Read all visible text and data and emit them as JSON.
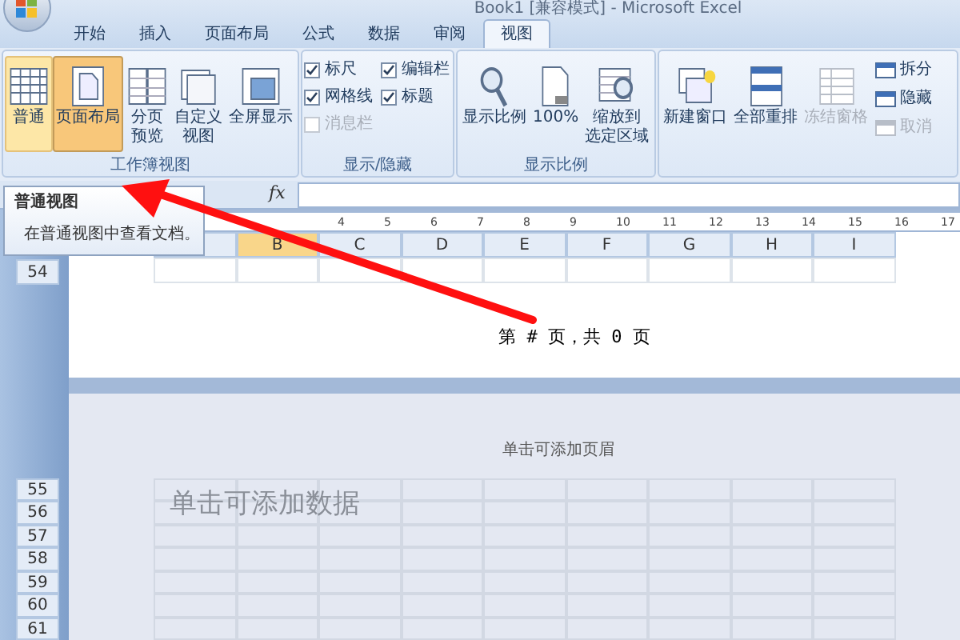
{
  "window": {
    "title": "Book1 [兼容模式] - Microsoft Excel"
  },
  "tabs": [
    {
      "label": "开始",
      "selected": false
    },
    {
      "label": "插入",
      "selected": false
    },
    {
      "label": "页面布局",
      "selected": false
    },
    {
      "label": "公式",
      "selected": false
    },
    {
      "label": "数据",
      "selected": false
    },
    {
      "label": "审阅",
      "selected": false
    },
    {
      "label": "视图",
      "selected": true
    }
  ],
  "workbook_views": {
    "label": "工作簿视图",
    "buttons": [
      {
        "lines": [
          "普通"
        ],
        "hovered": true,
        "selected": false
      },
      {
        "lines": [
          "页面布局"
        ],
        "hovered": false,
        "selected": true
      },
      {
        "lines": [
          "分页",
          "预览"
        ],
        "hovered": false,
        "selected": false
      },
      {
        "lines": [
          "自定义",
          "视图"
        ],
        "hovered": false,
        "selected": false
      },
      {
        "lines": [
          "全屏显示"
        ],
        "hovered": false,
        "selected": false
      }
    ]
  },
  "show_hide": {
    "label": "显示/隐藏",
    "checkboxes": [
      {
        "label": "标尺",
        "checked": true,
        "disabled": false
      },
      {
        "label": "编辑栏",
        "checked": true,
        "disabled": false
      },
      {
        "label": "网格线",
        "checked": true,
        "disabled": false
      },
      {
        "label": "标题",
        "checked": true,
        "disabled": false
      },
      {
        "label": "消息栏",
        "checked": false,
        "disabled": true
      }
    ]
  },
  "zoom": {
    "label": "显示比例",
    "buttons": [
      {
        "lines": [
          "显示比例"
        ]
      },
      {
        "lines": [
          "100%"
        ]
      },
      {
        "lines": [
          "缩放到",
          "选定区域"
        ]
      }
    ]
  },
  "window_group": {
    "buttons": [
      {
        "lines": [
          "新建窗口"
        ],
        "disabled": false
      },
      {
        "lines": [
          "全部重排"
        ],
        "disabled": false
      },
      {
        "lines": [
          "冻结窗格"
        ],
        "disabled": true
      }
    ],
    "small_buttons": [
      {
        "label": "拆分",
        "disabled": false
      },
      {
        "label": "隐藏",
        "disabled": false
      },
      {
        "label": "取消",
        "disabled": true
      }
    ]
  },
  "formula_bar": {
    "fx": "fx"
  },
  "tooltip": {
    "title": "普通视图",
    "text": "在普通视图中查看文档。"
  },
  "ruler": [
    "4",
    "5",
    "6",
    "7",
    "8",
    "9",
    "10",
    "11",
    "12",
    "13",
    "14",
    "15",
    "16",
    "17"
  ],
  "columns": [
    {
      "selected": false
    },
    {
      "label": "B",
      "selected": true
    },
    {
      "label": "C",
      "selected": false
    },
    {
      "label": "D",
      "selected": false
    },
    {
      "label": "E",
      "selected": false
    },
    {
      "label": "F",
      "selected": false
    },
    {
      "label": "G",
      "selected": false
    },
    {
      "label": "H",
      "selected": false
    },
    {
      "label": "I",
      "selected": false
    }
  ],
  "page1": {
    "rows": [
      "54"
    ],
    "footer": "第 # 页，共 0 页"
  },
  "page2": {
    "header": "单击可添加页眉",
    "placeholder": "单击可添加数据",
    "rows": [
      "55",
      "56",
      "57",
      "58",
      "59",
      "60",
      "61"
    ]
  }
}
